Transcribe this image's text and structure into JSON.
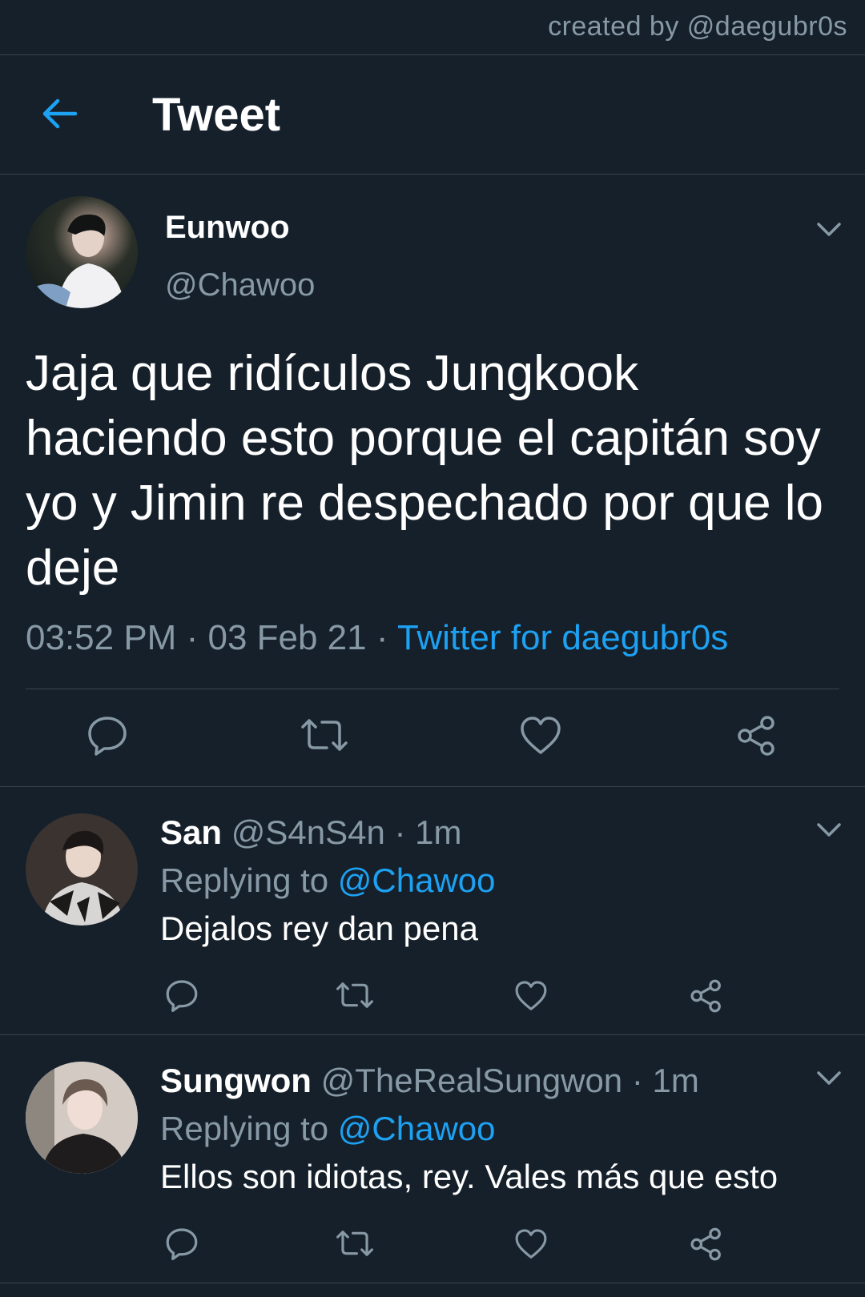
{
  "credit": "created by @daegubr0s",
  "header": {
    "title": "Tweet",
    "back_icon": "arrow-left-icon"
  },
  "colors": {
    "background": "#15202b",
    "accent": "#1da1f2",
    "muted": "#8899a6",
    "divider": "#38444d"
  },
  "main_tweet": {
    "name": "Eunwoo",
    "handle": "@Chawoo",
    "text": "Jaja que ridículos Jungkook haciendo esto porque el capitán soy yo y Jimin re despechado por que lo deje",
    "time": "03:52 PM",
    "date": "03 Feb 21",
    "separator": "·",
    "source": "Twitter for daegubr0s"
  },
  "replies": [
    {
      "name": "San",
      "handle": "@S4nS4n",
      "time": "1m",
      "separator": "·",
      "replying_prefix": "Replying to",
      "replying_to": "@Chawoo",
      "text": "Dejalos rey dan pena"
    },
    {
      "name": "Sungwon",
      "handle": "@TheRealSungwon",
      "time": "1m",
      "separator": "·",
      "replying_prefix": "Replying to",
      "replying_to": "@Chawoo",
      "text": "Ellos son idiotas, rey. Vales más que esto"
    }
  ]
}
